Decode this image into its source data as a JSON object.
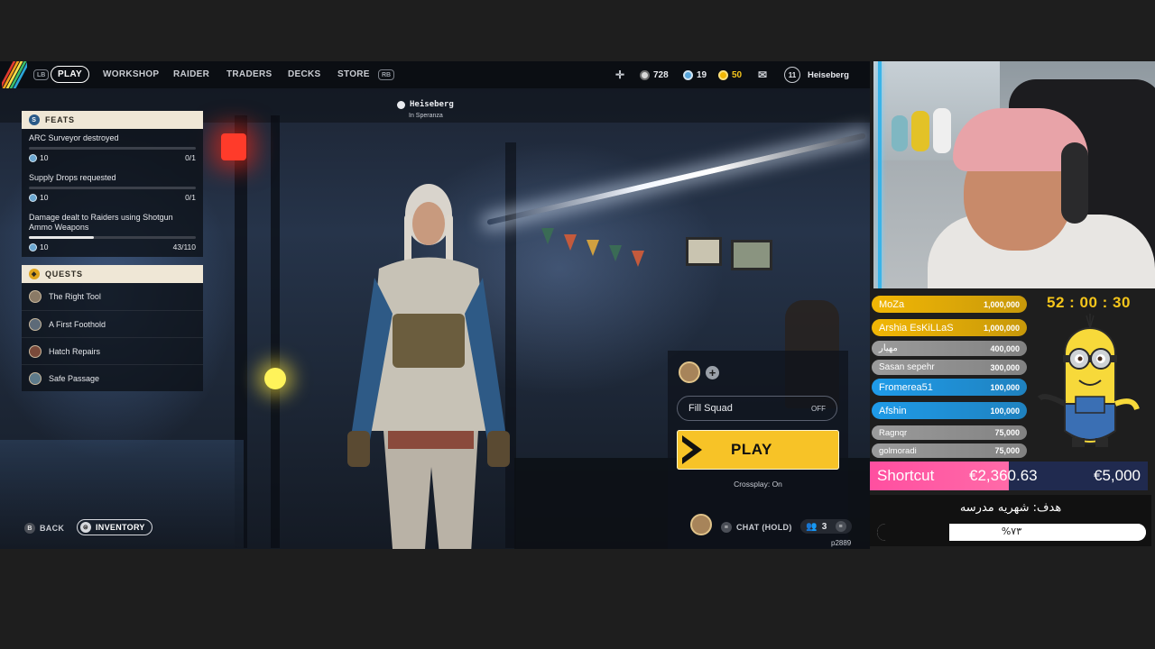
{
  "top_nav": {
    "lb_hint": "LB",
    "rb_hint": "RB",
    "items": [
      "PLAY",
      "WORKSHOP",
      "RAIDER",
      "TRADERS",
      "DECKS",
      "STORE"
    ],
    "coins": "728",
    "tokens": "19",
    "gold": "50",
    "level": "11",
    "username": "Heiseberg"
  },
  "presence": {
    "name": "Heiseberg",
    "location": "In Speranza"
  },
  "feats": {
    "header": "FEATS",
    "items": [
      {
        "title": "ARC Surveyor destroyed",
        "reward": "10",
        "progress": "0/1",
        "fraction": 0.0
      },
      {
        "title": "Supply Drops requested",
        "reward": "10",
        "progress": "0/1",
        "fraction": 0.0
      },
      {
        "title": "Damage dealt to Raiders using Shotgun Ammo Weapons",
        "reward": "10",
        "progress": "43/110",
        "fraction": 0.39
      }
    ]
  },
  "quests": {
    "header": "QUESTS",
    "items": [
      "The Right Tool",
      "A First Foothold",
      "Hatch Repairs",
      "Safe Passage"
    ]
  },
  "squad": {
    "fill_squad_label": "Fill Squad",
    "fill_squad_value": "OFF",
    "play_label": "PLAY",
    "crossplay": "Crossplay: On"
  },
  "bottom": {
    "back_hint": "B",
    "back_label": "BACK",
    "inventory_label": "INVENTORY",
    "chat_label": "CHAT (HOLD)",
    "party_count": "3",
    "build_id": "p2889"
  },
  "stream": {
    "timer": "52 : 00 : 30",
    "donations": [
      {
        "name": "MoZa",
        "amount": "1,000,000",
        "color": "#f2b705"
      },
      {
        "name": "Arshia EsKiLLaS",
        "amount": "1,000,000",
        "color": "#f2b705"
      },
      {
        "name": "مهیار",
        "amount": "400,000",
        "color": "#9b9b9b"
      },
      {
        "name": "Sasan sepehr",
        "amount": "300,000",
        "color": "#9b9b9b"
      },
      {
        "name": "Fromerea51",
        "amount": "100,000",
        "color": "#1f9be8"
      },
      {
        "name": "Afshin",
        "amount": "100,000",
        "color": "#1f9be8"
      },
      {
        "name": "Ragnqr",
        "amount": "75,000",
        "color": "#9b9b9b"
      },
      {
        "name": "golmoradi",
        "amount": "75,000",
        "color": "#9b9b9b"
      }
    ],
    "goal_label": "Shortcut",
    "goal_current": "€2,360.63",
    "goal_target": "€5,000",
    "goal_title": "هدف: شهریه مدرسه",
    "goal_percent_text": "%۷۳",
    "goal_fraction": 0.73
  }
}
